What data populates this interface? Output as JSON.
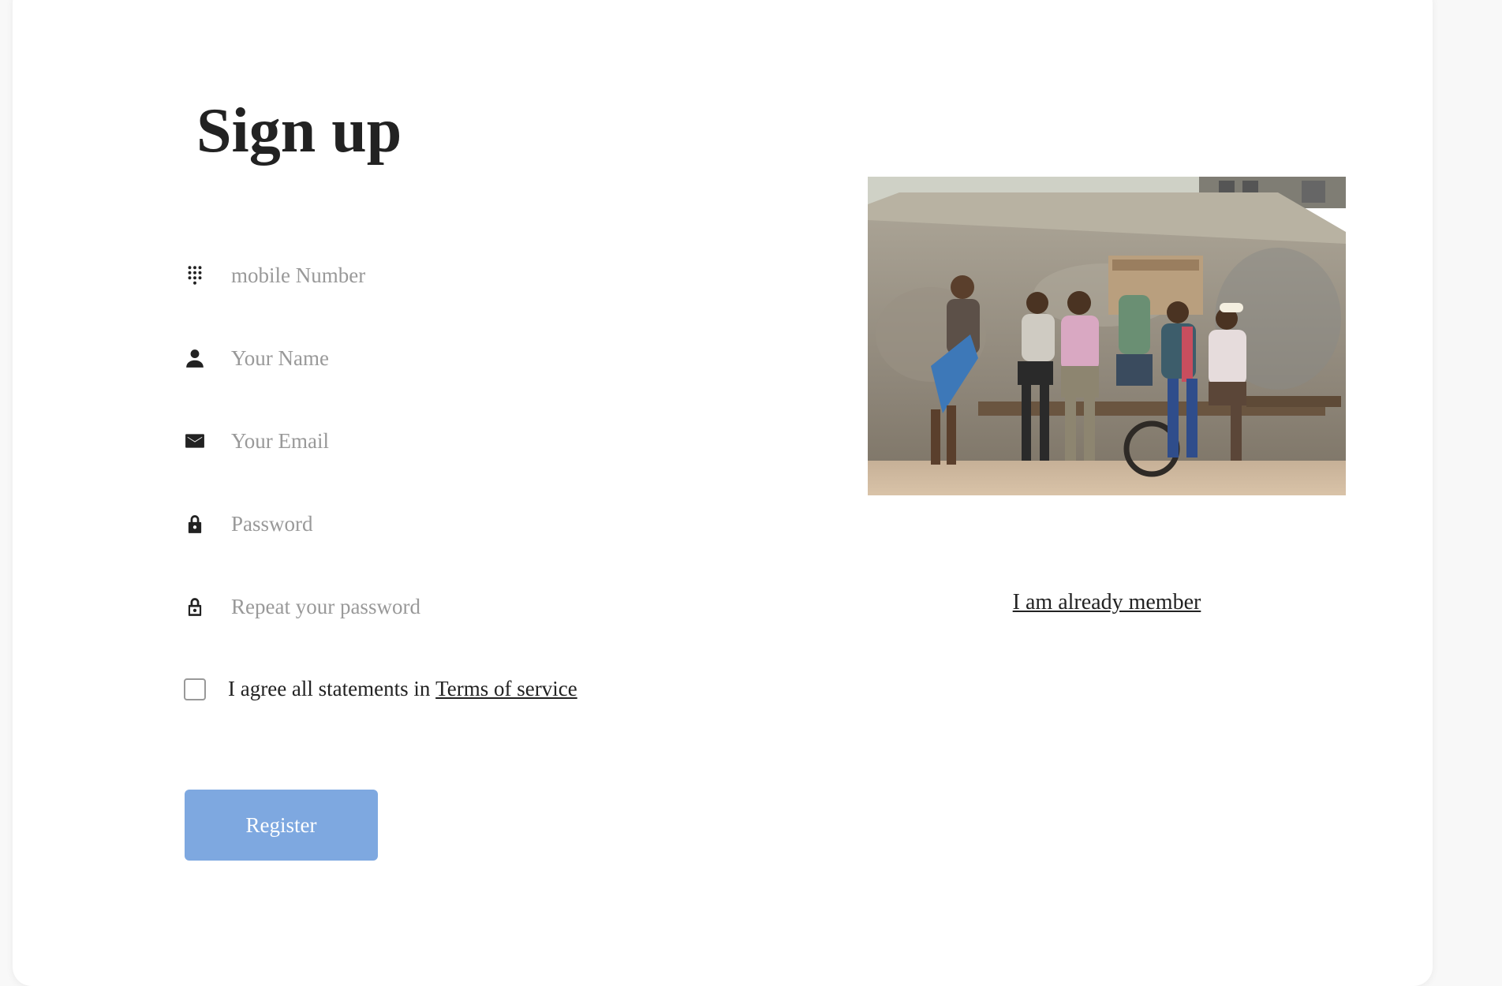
{
  "form": {
    "title": "Sign up",
    "fields": [
      {
        "icon": "dialpad-icon",
        "placeholder": "mobile Number",
        "value": ""
      },
      {
        "icon": "person-icon",
        "placeholder": "Your Name",
        "value": ""
      },
      {
        "icon": "email-icon",
        "placeholder": "Your Email",
        "value": ""
      },
      {
        "icon": "lock-icon",
        "placeholder": "Password",
        "value": ""
      },
      {
        "icon": "lock-outline-icon",
        "placeholder": "Repeat your password",
        "value": ""
      }
    ],
    "agree_text": "I agree all statements in ",
    "terms_link": "Terms of service",
    "register_label": "Register"
  },
  "aside": {
    "image_desc": "group-of-men-sitting-photo",
    "member_link": "I am already member"
  },
  "colors": {
    "button": "#7ea8e0",
    "title": "#222222",
    "placeholder": "#999999"
  }
}
